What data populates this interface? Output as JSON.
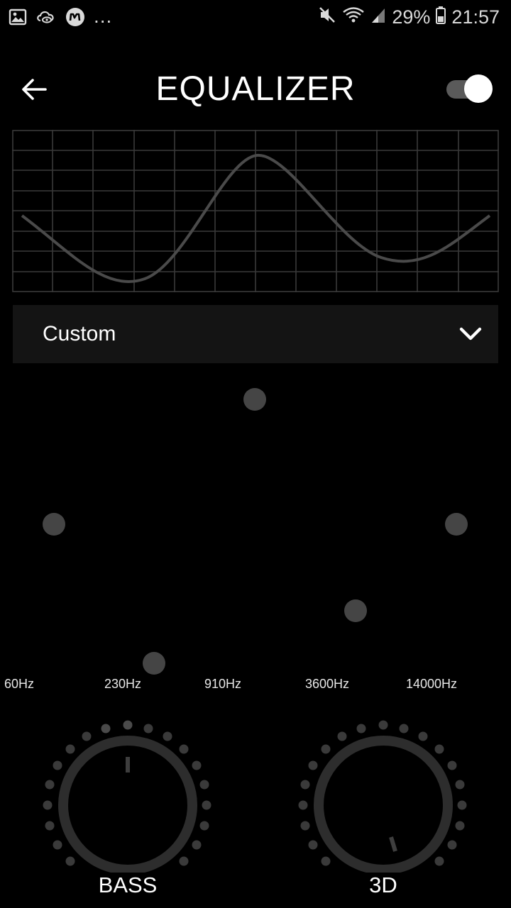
{
  "status_bar": {
    "dots": "...",
    "battery": "29%",
    "time": "21:57",
    "icons": [
      "gallery-icon",
      "cloud-eye-icon",
      "m-logo-icon",
      "mute-icon",
      "wifi-icon",
      "signal-icon",
      "battery-icon"
    ]
  },
  "header": {
    "title": "EQUALIZER",
    "back_icon": "arrow-left-icon",
    "toggle_on": true
  },
  "preset": {
    "value": "Custom",
    "icon": "chevron-down-icon"
  },
  "bands": [
    {
      "label": "60Hz"
    },
    {
      "label": "230Hz"
    },
    {
      "label": "910Hz"
    },
    {
      "label": "3600Hz"
    },
    {
      "label": "14000Hz"
    }
  ],
  "knobs": [
    {
      "label": "BASS"
    },
    {
      "label": "3D"
    }
  ],
  "colors": {
    "background": "#000000",
    "curve": "#4a4a4a",
    "grid": "#3a3a3a",
    "thumb": "#454545",
    "knob_ring": "#2d2d2d",
    "dots": "#3a3a3a"
  }
}
